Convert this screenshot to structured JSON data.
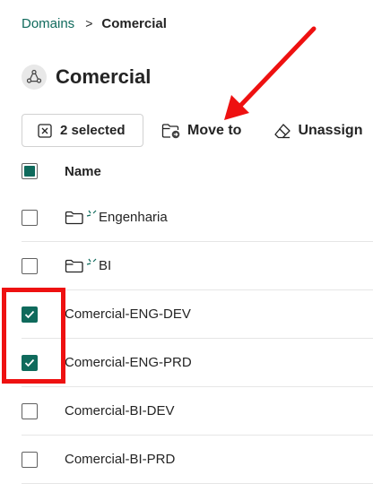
{
  "breadcrumb": {
    "root": "Domains",
    "separator": ">",
    "current": "Comercial"
  },
  "page": {
    "title": "Comercial",
    "icon": "domain-icon"
  },
  "toolbar": {
    "selected_label": "2 selected",
    "move_label": "Move to",
    "unassign_label": "Unassign"
  },
  "table": {
    "header": {
      "name": "Name",
      "select_all_state": "partial"
    },
    "rows": [
      {
        "name": "Engenharia",
        "type": "folder",
        "checked": false
      },
      {
        "name": "BI",
        "type": "folder",
        "checked": false
      },
      {
        "name": "Comercial-ENG-DEV",
        "type": "workspace",
        "checked": true
      },
      {
        "name": "Comercial-ENG-PRD",
        "type": "workspace",
        "checked": true
      },
      {
        "name": "Comercial-BI-DEV",
        "type": "workspace",
        "checked": false
      },
      {
        "name": "Comercial-BI-PRD",
        "type": "workspace",
        "checked": false
      }
    ]
  },
  "colors": {
    "accent": "#0f6a5c",
    "annotation": "#ee1111"
  }
}
